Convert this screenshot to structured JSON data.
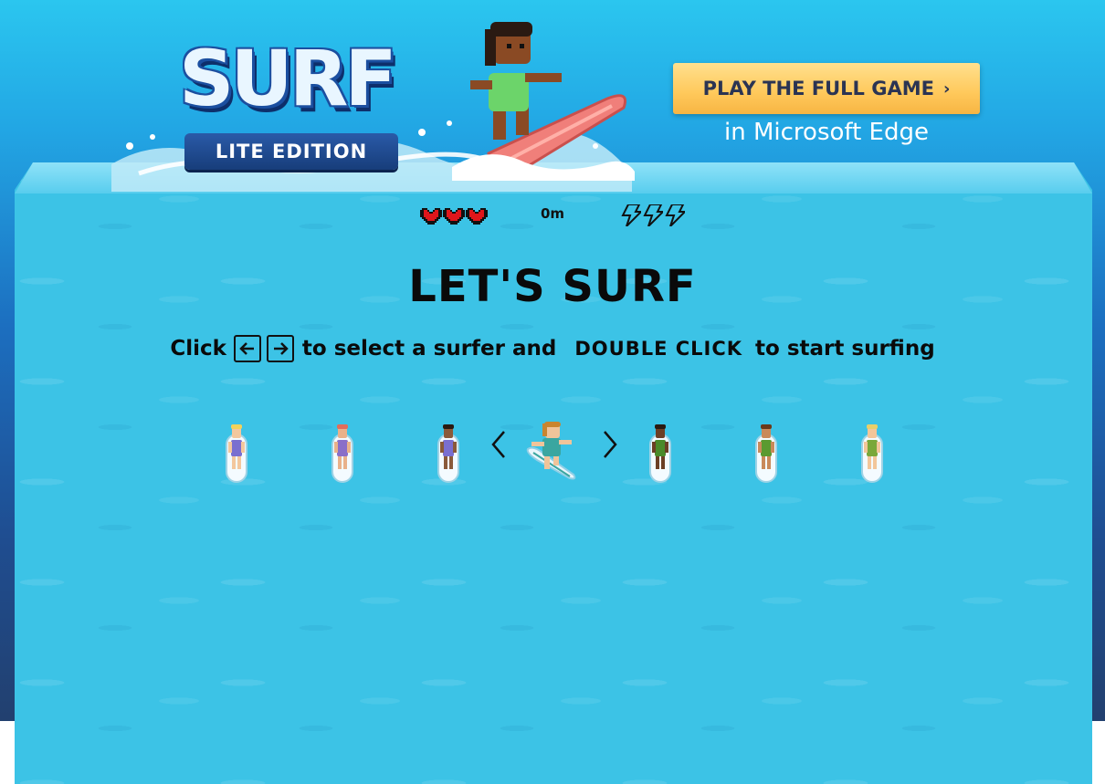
{
  "logo": {
    "title": "SURF",
    "edition": "LITE EDITION"
  },
  "cta": {
    "button_label": "PLAY THE FULL GAME",
    "subtitle": "in Microsoft Edge"
  },
  "hud": {
    "hearts": 3,
    "distance": "0m",
    "boosts": 3,
    "heart_icon": "heart-icon",
    "boost_icon": "lightning-icon"
  },
  "screen": {
    "title": "LET'S SURF",
    "instruction_click": "Click",
    "instruction_select": "to select a surfer and",
    "instruction_double": "DOUBLE CLICK",
    "instruction_start": "to start surfing"
  },
  "surfers": [
    {
      "hair": "#f2d25a",
      "skin": "#f3c79d",
      "outfit": "#7a6fd0"
    },
    {
      "hair": "#e26d5a",
      "skin": "#e9b18a",
      "outfit": "#8a6fc8"
    },
    {
      "hair": "#2a1a12",
      "skin": "#8a5a3a",
      "outfit": "#7a6fd0"
    },
    {
      "hair": "#2a1a12",
      "skin": "#6b3f25",
      "outfit": "#4a8a2a"
    },
    {
      "hair": "#6b3a1a",
      "skin": "#c98a5a",
      "outfit": "#5a9a30"
    },
    {
      "hair": "#e8cf6a",
      "skin": "#f2c69a",
      "outfit": "#7aa83a"
    }
  ],
  "selected_surfer": {
    "hair": "#c9852f",
    "skin": "#f0c49a",
    "outfit": "#3aa6a0"
  },
  "colors": {
    "cta_bg": "#ffc85a",
    "cta_text": "#2b3453",
    "water": "#3cc3e6",
    "heart": "#e0161b"
  }
}
